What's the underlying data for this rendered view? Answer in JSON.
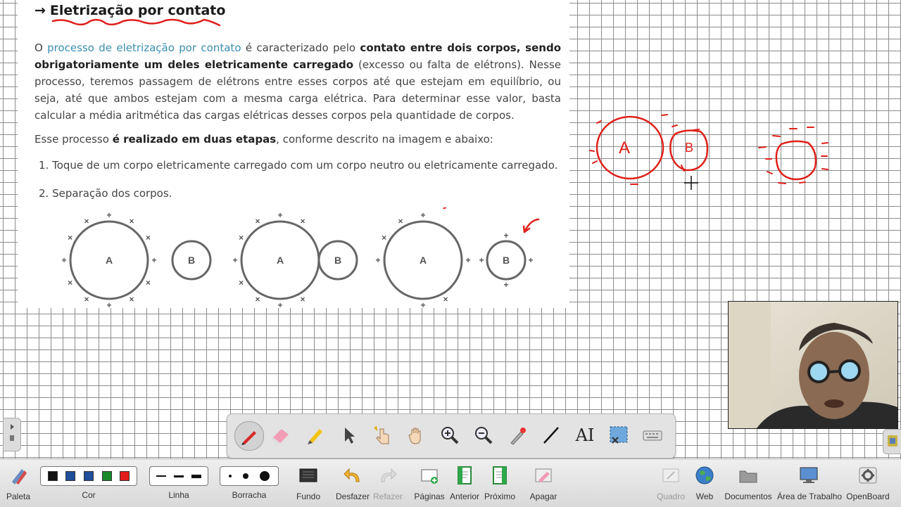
{
  "document": {
    "title_arrow": "→",
    "title": "Eletrização por contato",
    "p1": {
      "t1": "O ",
      "link": "processo de eletrização por contato",
      "t2": " é caracterizado pelo ",
      "b1": "contato entre dois corpos, sendo obrigatoriamente um deles eletricamente carregado",
      "t3": " (excesso ou falta de elétrons). Nesse processo, teremos passagem de elétrons entre esses corpos até que estejam em equilíbrio, ou seja, até que ambos estejam com a mesma carga elétrica. Para determinar esse valor, basta calcular a média aritmética das cargas elétricas desses corpos pela quantidade de corpos."
    },
    "p2": {
      "t1": "Esse processo ",
      "b1": "é realizado em duas etapas",
      "t2": ", conforme descrito na imagem e abaixo:"
    },
    "steps": [
      "1. Toque de um corpo eletricamente carregado com um corpo neutro ou eletricamente carregado.",
      "2. Separação dos corpos."
    ],
    "diagram": {
      "labels": [
        "A",
        "B",
        "A",
        "B",
        "A",
        "B"
      ],
      "plus": "+",
      "minus": "×"
    }
  },
  "annotation": {
    "circle_a": "A",
    "circle_b": "B"
  },
  "floating_toolbar": {
    "tools": [
      "pen-icon",
      "eraser-icon",
      "highlighter-icon",
      "pointer-icon",
      "interact-icon",
      "hand-icon",
      "zoom-in-icon",
      "zoom-out-icon",
      "laser-icon",
      "line-icon",
      "text-icon",
      "capture-icon",
      "keyboard-icon"
    ],
    "text_tool_glyph": "AI"
  },
  "bottom_bar": {
    "paleta": "Paleta",
    "cor": "Cor",
    "linha": "Linha",
    "borracha": "Borracha",
    "fundo": "Fundo",
    "desfazer": "Desfazer",
    "refazer": "Refazer",
    "paginas": "Páginas",
    "anterior": "Anterior",
    "proximo": "Próximo",
    "apagar": "Apagar",
    "quadro": "Quadro",
    "web": "Web",
    "documentos": "Documentos",
    "area_trabalho": "Área de Trabalho",
    "openboard": "OpenBoard"
  },
  "colors": {
    "annotation_red": "#e0201a",
    "link_blue": "#3a8fb2",
    "swatches": [
      "#111111",
      "#1f4e9a",
      "#1f4e9a",
      "#1a8a2a",
      "#e11d1d"
    ]
  }
}
